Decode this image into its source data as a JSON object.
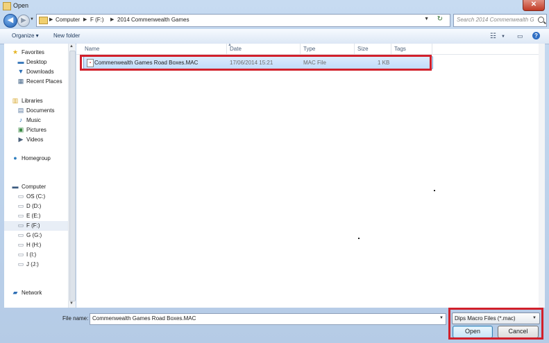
{
  "window": {
    "title": "Open",
    "close_glyph": "✕"
  },
  "nav": {
    "back_glyph": "◀",
    "forward_glyph": "▶",
    "breadcrumbs": [
      "Computer",
      "F (F:)",
      "2014 Commenwealth Games"
    ],
    "search_placeholder": "Search 2014 Commenwealth G..."
  },
  "toolbar": {
    "organize_label": "Organize ▾",
    "new_folder_label": "New folder",
    "help_glyph": "?"
  },
  "sidebar": {
    "favorites": {
      "label": "Favorites",
      "items": [
        "Desktop",
        "Downloads",
        "Recent Places"
      ]
    },
    "libraries": {
      "label": "Libraries",
      "items": [
        "Documents",
        "Music",
        "Pictures",
        "Videos"
      ]
    },
    "homegroup": {
      "label": "Homegroup"
    },
    "computer": {
      "label": "Computer",
      "items": [
        "OS (C:)",
        "D (D:)",
        "E (E:)",
        "F (F:)",
        "G (G:)",
        "H (H:)",
        "I (I:)",
        "J (J:)"
      ],
      "selected": "F (F:)"
    },
    "network": {
      "label": "Network"
    }
  },
  "columns": [
    "Name",
    "Date",
    "Type",
    "Size",
    "Tags"
  ],
  "files": [
    {
      "name": "Commenwealth Games Road Boxes.MAC",
      "date": "17/06/2014 15:21",
      "type": "MAC File",
      "size": "1 KB"
    }
  ],
  "footer": {
    "file_name_label": "File name:",
    "file_name_value": "Commenwealth Games Road Boxes.MAC",
    "file_type_value": "Dips Macro Files (*.mac)",
    "open_label": "Open",
    "cancel_label": "Cancel"
  },
  "colors": {
    "highlight_box": "#d1202b",
    "selection": "#c1dcfb"
  }
}
